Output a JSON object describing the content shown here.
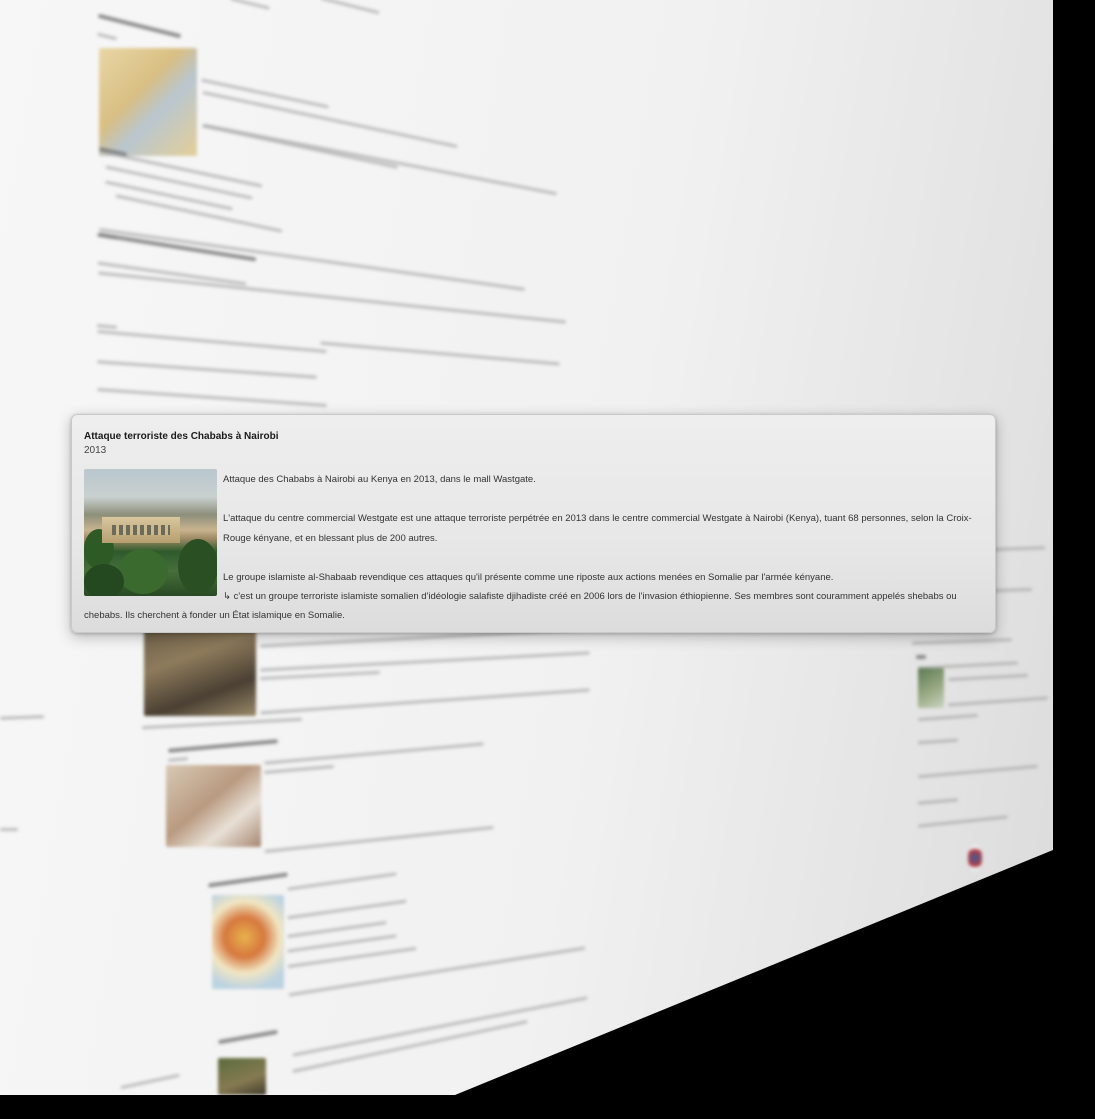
{
  "popup": {
    "title": "Attaque terroriste des Chababs à Nairobi",
    "year": "2013",
    "image_alt": "Photo du centre commercial Westgate à Nairobi",
    "paragraph1": "Attaque des Chababs à Nairobi au Kenya en 2013, dans le mall Wastgate.",
    "paragraph2": "L'attaque du centre commercial Westgate est une attaque terroriste perpétrée en 2013 dans le centre commercial Westgate à Nairobi (Kenya), tuant 68 personnes, selon la Croix-Rouge kényane, et en blessant plus de 200 autres.",
    "paragraph3": "Le groupe islamiste al-Shabaab revendique ces attaques qu'il présente comme une riposte aux actions menées en Somalie par l'armée kényane.",
    "paragraph4_start": "↳ c'est un groupe terroriste islamiste somalien d'idéologie salafiste djihadiste créé en 2006 lors de l'invasion éthiopienne. Ses membres sont couramment appelés shebabs  ou",
    "paragraph4_end": "chebabs. Ils cherchent à fonder un État islamique en Somalie."
  }
}
